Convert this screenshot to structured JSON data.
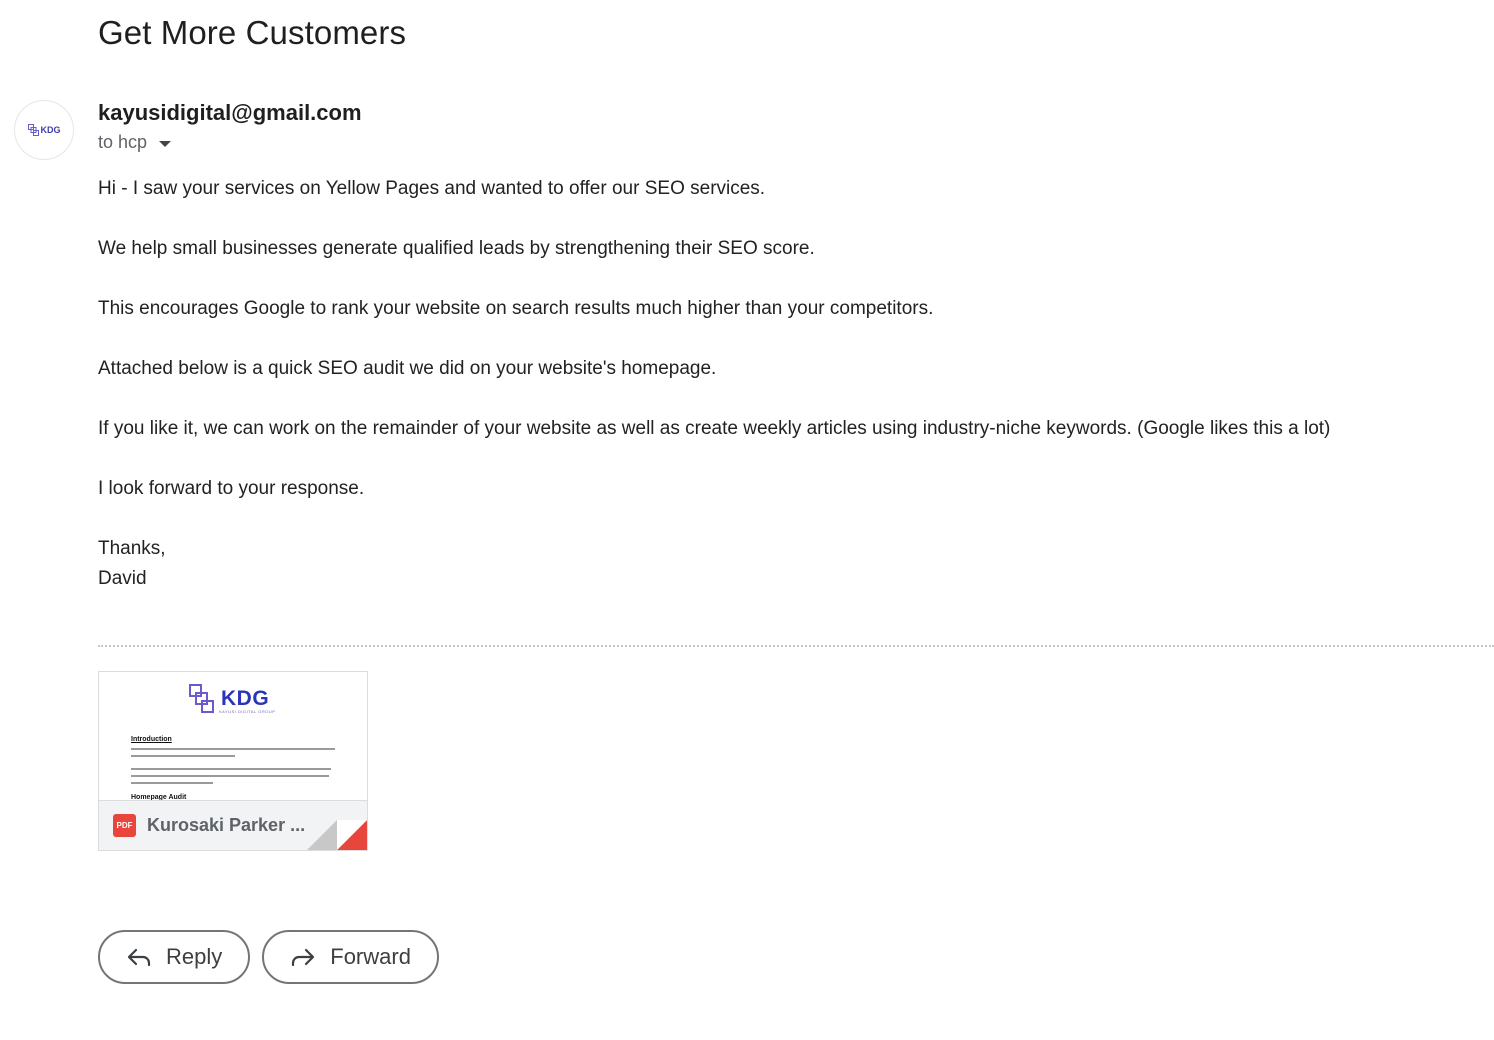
{
  "email": {
    "subject": "Get More Customers",
    "sender": "kayusidigital@gmail.com",
    "recipient": "to hcp",
    "avatar_logo_text": "KDG",
    "avatar_icon": "kdg-logo-icon",
    "body": [
      "Hi - I saw your services on Yellow Pages and wanted to offer our SEO services.",
      "We help small businesses generate qualified leads by strengthening their SEO score.",
      "This encourages Google to rank your website on search results much higher than your competitors.",
      "Attached below is a quick SEO audit we did on your website's homepage.",
      "If you like it, we can work on the remainder of your website as well as create weekly articles using industry-niche keywords. (Google likes this a lot)",
      "I look forward to your response."
    ],
    "signoff": "Thanks,",
    "signature": "David"
  },
  "attachment": {
    "file_name": "Kurosaki Parker ...",
    "file_type_label": "PDF",
    "file_type_icon": "pdf-icon",
    "preview": {
      "logo_text": "KDG",
      "logo_subtext": "KAYUSI DIGITAL GROUP",
      "section1_heading": "Introduction",
      "section2_heading": "Homepage Audit"
    }
  },
  "actions": {
    "reply_label": "Reply",
    "reply_icon": "reply-arrow-icon",
    "forward_label": "Forward",
    "forward_icon": "forward-arrow-icon"
  },
  "colors": {
    "brand_blue": "#2b35b8",
    "pdf_red": "#e8453c",
    "button_border": "#757575"
  }
}
